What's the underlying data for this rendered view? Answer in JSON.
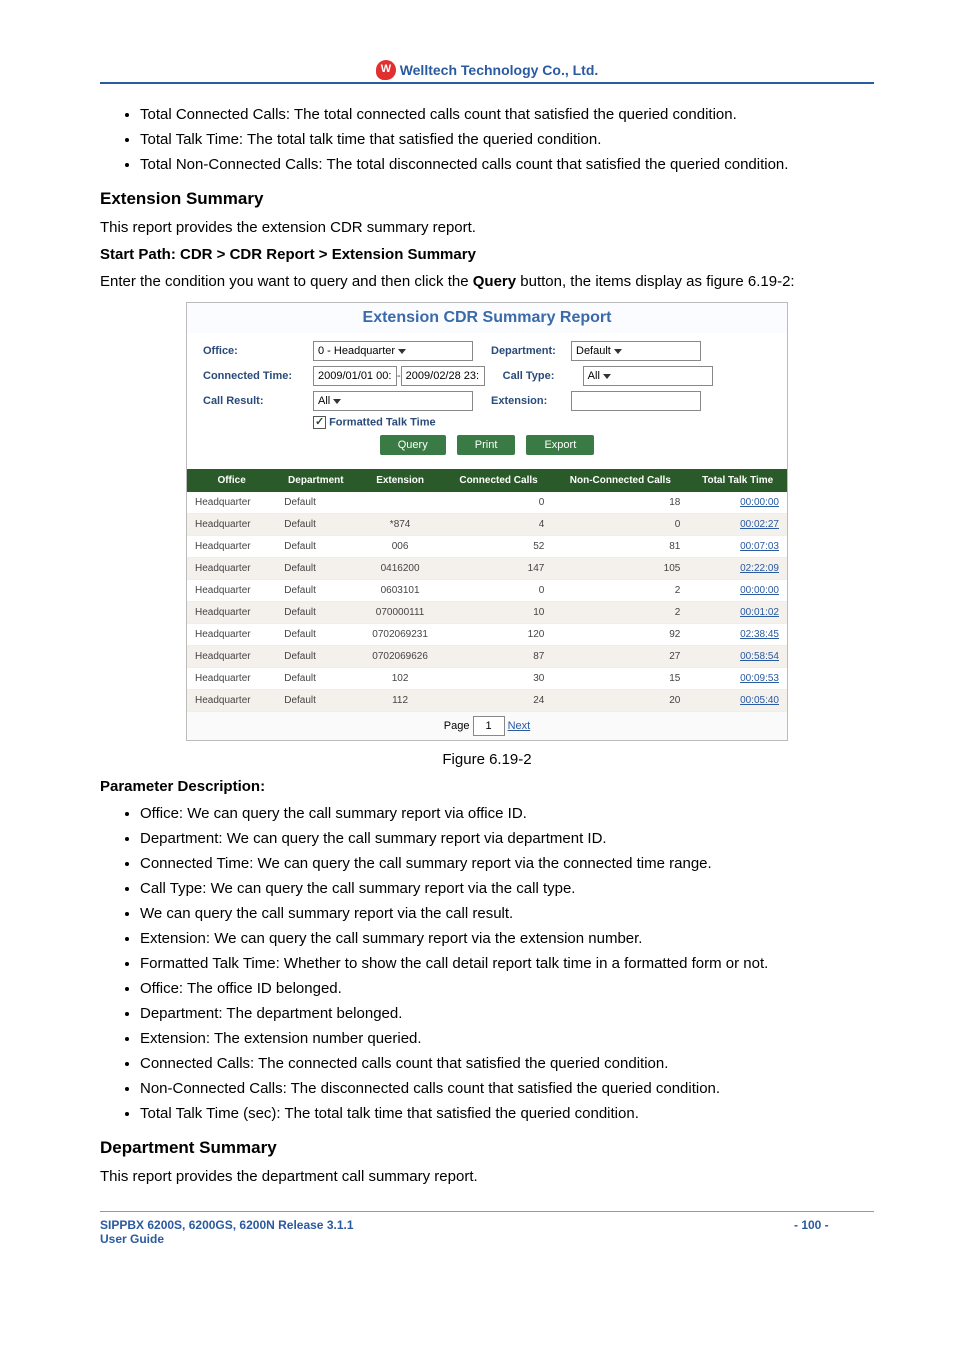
{
  "header": {
    "company": "Welltech Technology Co., Ltd."
  },
  "top_bullets": [
    "Total Connected Calls: The total connected calls count that satisfied the queried condition.",
    "Total Talk Time: The total talk time that satisfied the queried condition.",
    "Total Non-Connected Calls: The total disconnected calls count that satisfied the queried condition."
  ],
  "ext_summary": {
    "heading": "Extension Summary",
    "intro": "This report provides the extension CDR summary report.",
    "path_label": "Start Path: CDR > CDR Report > Extension Summary",
    "instruction_prefix": "Enter the condition you want to query and then click the ",
    "instruction_bold": "Query",
    "instruction_suffix": " button, the items display as figure 6.19-2:"
  },
  "chart_data": {
    "type": "table",
    "title": "Extension CDR Summary Report",
    "form": {
      "office_label": "Office:",
      "office_value": "0 - Headquarter",
      "department_label": "Department:",
      "department_value": "Default",
      "connected_time_label": "Connected Time:",
      "connected_time_from": "2009/01/01 00:",
      "connected_time_to": "2009/02/28 23:",
      "call_type_label": "Call Type:",
      "call_type_value": "All",
      "call_result_label": "Call Result:",
      "call_result_value": "All",
      "extension_label": "Extension:",
      "extension_value": "",
      "formatted_checkbox": "Formatted Talk Time",
      "query_btn": "Query",
      "print_btn": "Print",
      "export_btn": "Export"
    },
    "columns": [
      "Office",
      "Department",
      "Extension",
      "Connected Calls",
      "Non-Connected Calls",
      "Total Talk Time"
    ],
    "rows": [
      [
        "Headquarter",
        "Default",
        "",
        "0",
        "18",
        "00:00:00"
      ],
      [
        "Headquarter",
        "Default",
        "*874",
        "4",
        "0",
        "00:02:27"
      ],
      [
        "Headquarter",
        "Default",
        "006",
        "52",
        "81",
        "00:07:03"
      ],
      [
        "Headquarter",
        "Default",
        "0416200",
        "147",
        "105",
        "02:22:09"
      ],
      [
        "Headquarter",
        "Default",
        "0603101",
        "0",
        "2",
        "00:00:00"
      ],
      [
        "Headquarter",
        "Default",
        "070000111",
        "10",
        "2",
        "00:01:02"
      ],
      [
        "Headquarter",
        "Default",
        "0702069231",
        "120",
        "92",
        "02:38:45"
      ],
      [
        "Headquarter",
        "Default",
        "0702069626",
        "87",
        "27",
        "00:58:54"
      ],
      [
        "Headquarter",
        "Default",
        "102",
        "30",
        "15",
        "00:09:53"
      ],
      [
        "Headquarter",
        "Default",
        "112",
        "24",
        "20",
        "00:05:40"
      ]
    ],
    "pager_page_label": "Page",
    "pager_page": "1",
    "pager_next": "Next",
    "caption": "Figure 6.19-2"
  },
  "param_desc": {
    "heading": "Parameter Description:",
    "items": [
      "Office: We can query the call summary report via office ID.",
      "Department: We can query the call summary report via department ID.",
      "Connected Time: We can query the call summary report via the connected time range.",
      "Call Type: We can query the call summary report via the call type.",
      "We can query the call summary report via the call result.",
      "Extension: We can query the call summary report via the extension number.",
      "Formatted Talk Time: Whether to show the call detail report talk time in a formatted form or not.",
      "Office: The office ID belonged.",
      "Department: The department belonged.",
      "Extension: The extension number queried.",
      "Connected Calls: The connected calls count that satisfied the queried condition.",
      "Non-Connected Calls: The disconnected calls count that satisfied the queried condition.",
      "Total Talk Time (sec): The total talk time that satisfied the queried condition."
    ]
  },
  "dept_summary": {
    "heading": "Department Summary",
    "intro": "This report provides the department call summary report."
  },
  "footer": {
    "line1": "SIPPBX 6200S, 6200GS, 6200N Release 3.1.1",
    "line2": "User Guide",
    "page": "- 100 -"
  }
}
